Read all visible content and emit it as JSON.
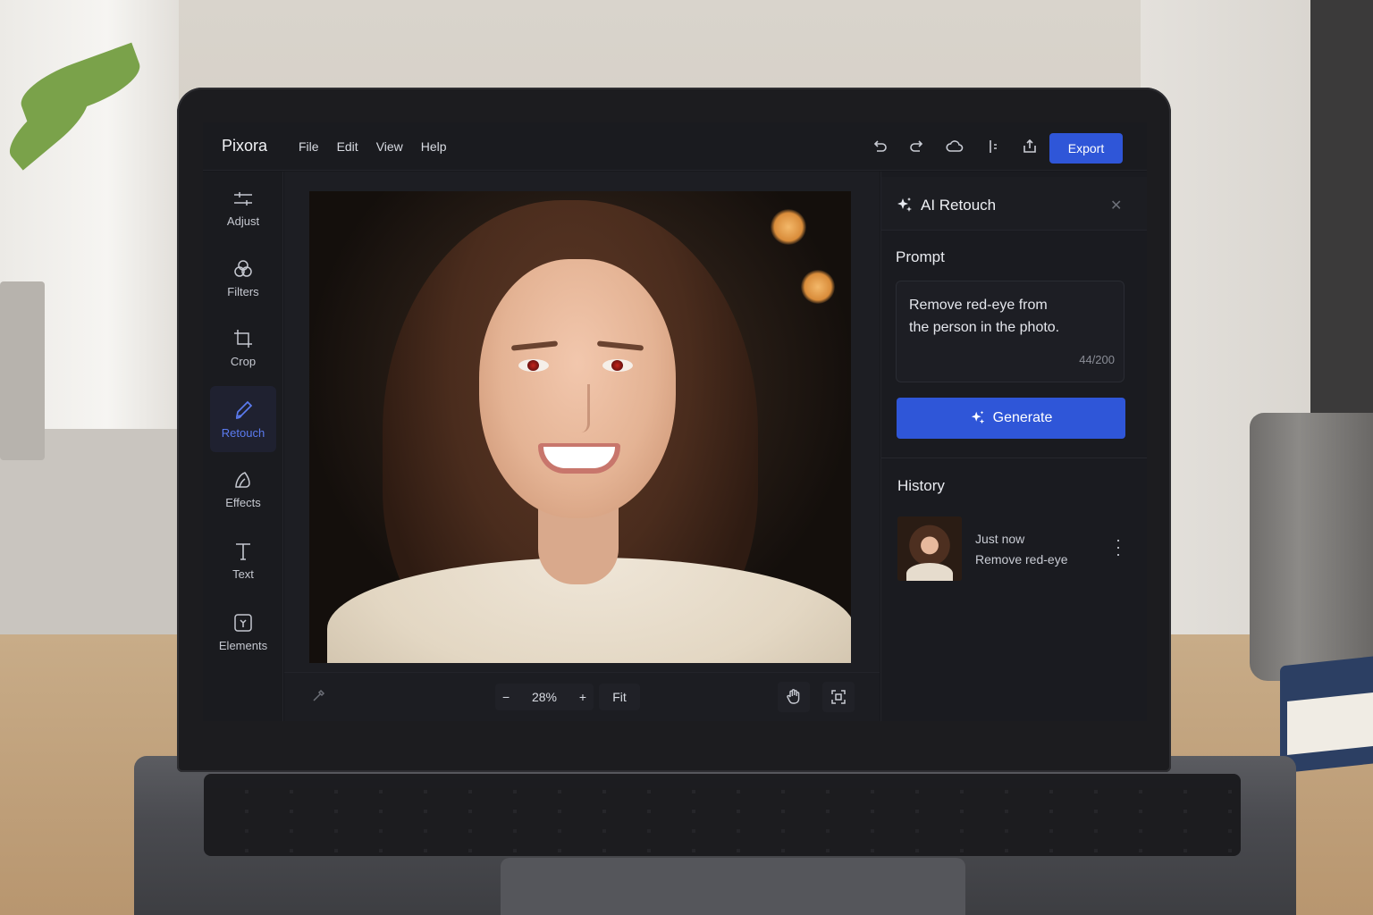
{
  "app": {
    "brand": "Pixora",
    "menu": [
      "File",
      "Edit",
      "View",
      "Help"
    ],
    "toolbar_icons": [
      "undo-icon",
      "redo-icon",
      "cloud-icon",
      "compare-icon",
      "share-icon"
    ],
    "export_label": "Export",
    "accent": "#2f56d8"
  },
  "tools": [
    {
      "label": "Adjust",
      "icon": "sliders-icon"
    },
    {
      "label": "Filters",
      "icon": "filters-icon"
    },
    {
      "label": "Crop",
      "icon": "crop-icon"
    },
    {
      "label": "Retouch",
      "icon": "retouch-brush-icon",
      "active": true
    },
    {
      "label": "Effects",
      "icon": "effects-icon"
    },
    {
      "label": "Text",
      "icon": "text-icon"
    },
    {
      "label": "Elements",
      "icon": "elements-icon"
    }
  ],
  "canvas": {
    "zoom": "28%",
    "zoom_out_symbol": "−",
    "zoom_in_symbol": "+",
    "fit_label": "Fit",
    "bottom_icons": [
      "hand-tool-icon",
      "fullscreen-icon"
    ]
  },
  "panel": {
    "title": "AI Retouch",
    "prompt_label": "Prompt",
    "prompt_line1": "Remove red-eye from",
    "prompt_line2": "the person in the photo.",
    "counter": "44/200",
    "generate_label": "Generate",
    "history_label": "History",
    "history": [
      {
        "time": "Just now",
        "description": "Remove red-eye"
      }
    ]
  }
}
